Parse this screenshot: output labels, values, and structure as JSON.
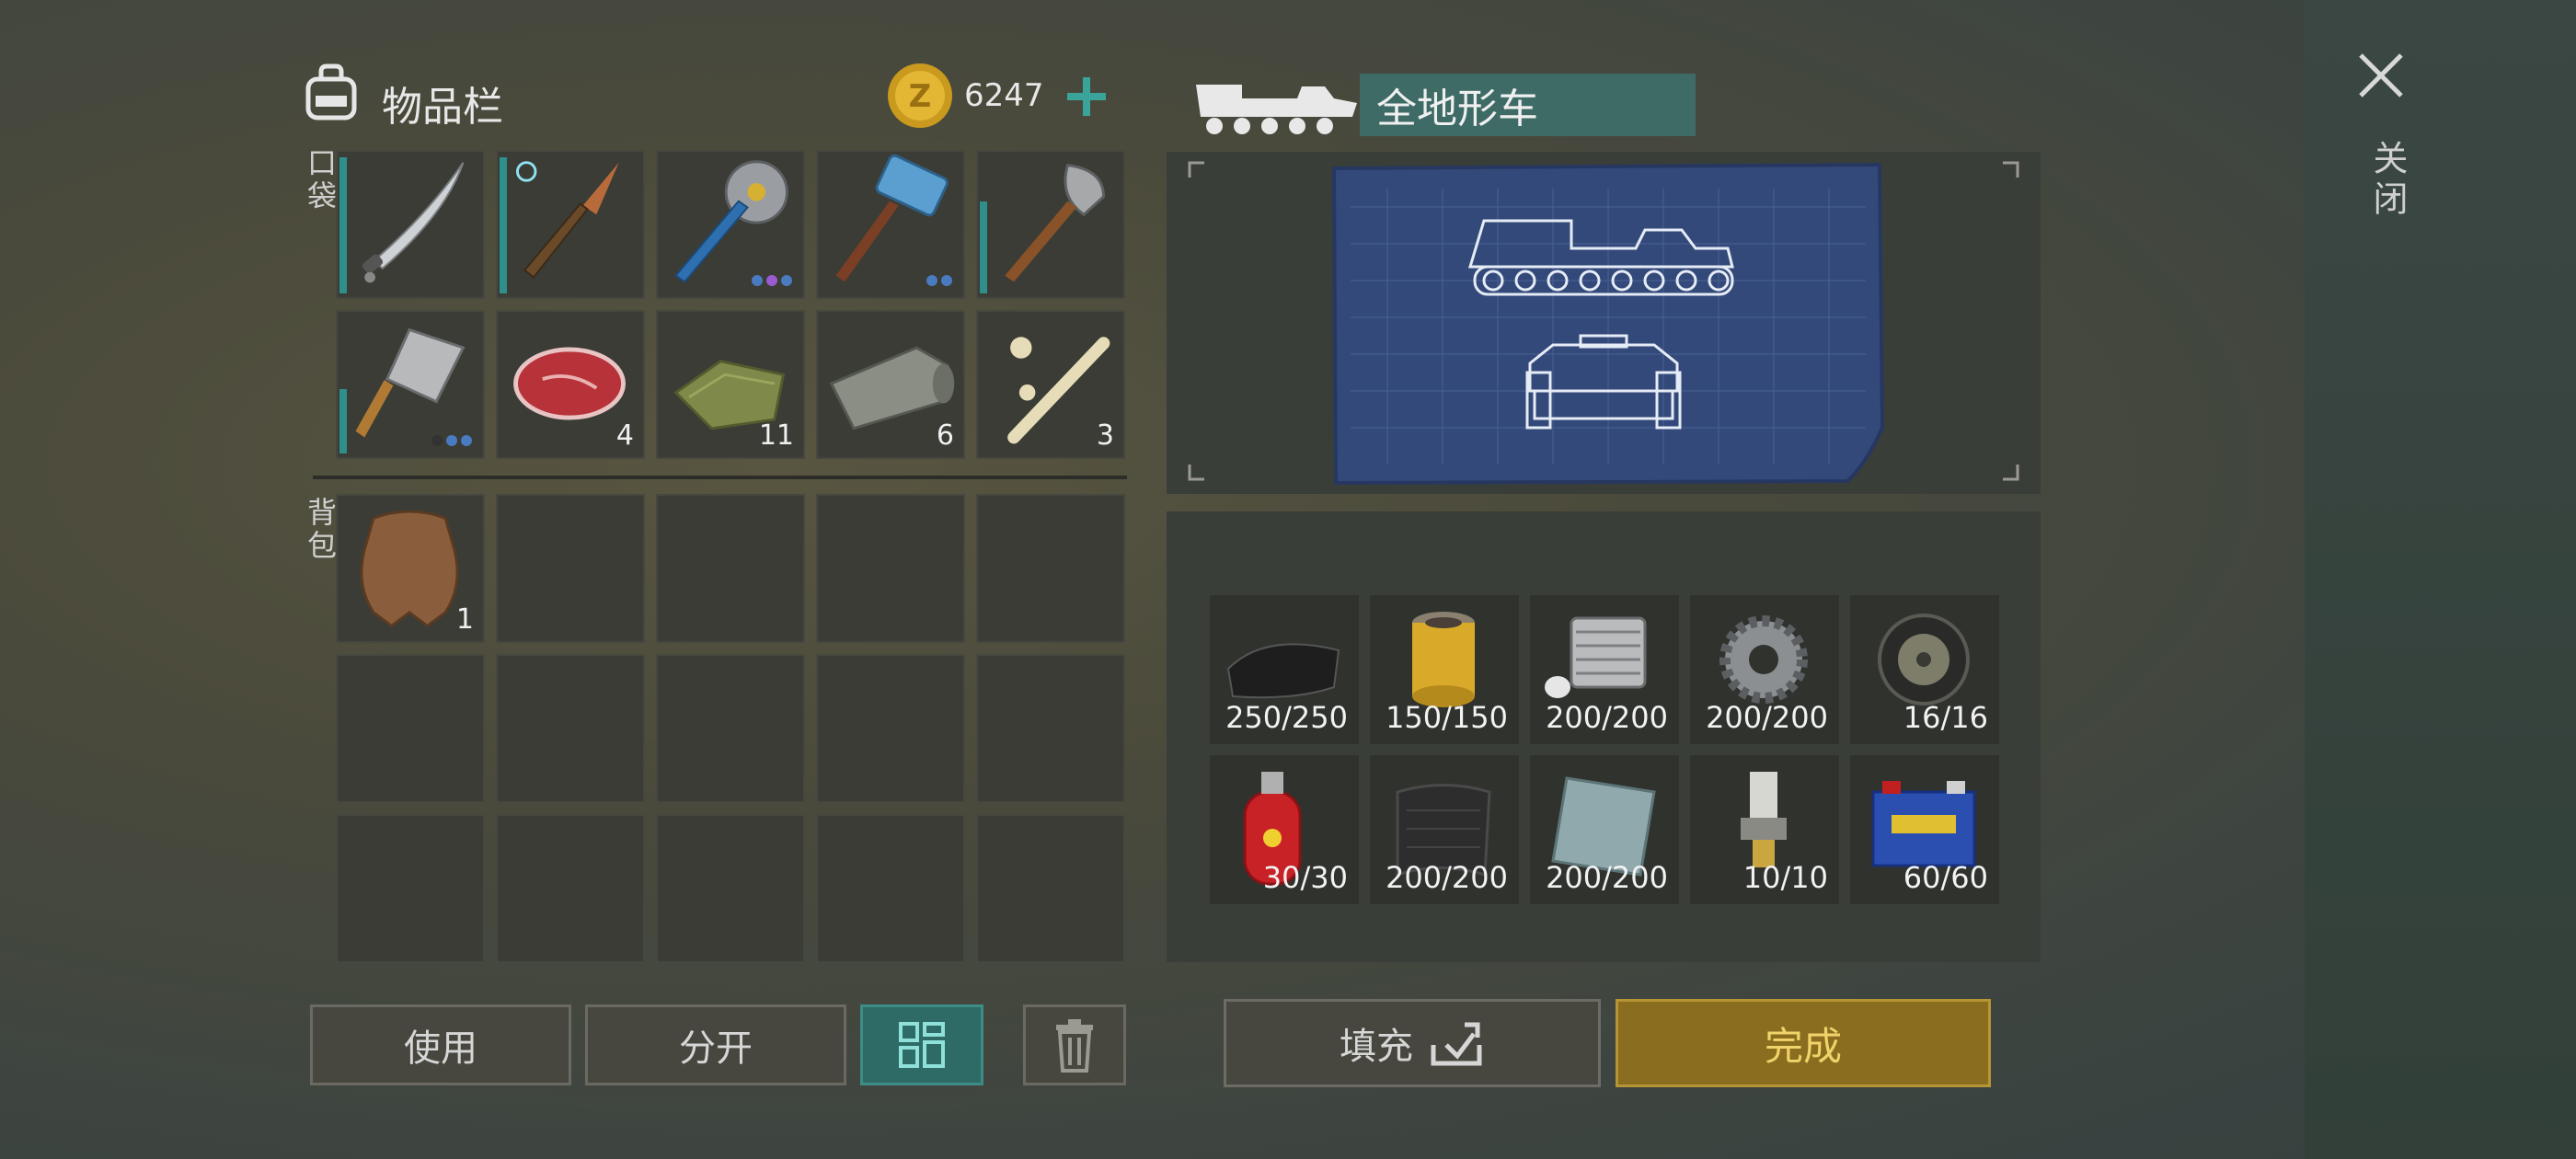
{
  "inventory": {
    "title": "物品栏",
    "pocket_label": "口袋",
    "backpack_label": "背包",
    "coins": "6247",
    "pocket_items": [
      {
        "name": "machete",
        "count": ""
      },
      {
        "name": "frost-knife",
        "count": ""
      },
      {
        "name": "saw-blade-club",
        "count": ""
      },
      {
        "name": "sledgehammer",
        "count": ""
      },
      {
        "name": "shovel",
        "count": ""
      },
      {
        "name": "cleaver",
        "count": ""
      },
      {
        "name": "raw-meat",
        "count": "4"
      },
      {
        "name": "cloth",
        "count": "11"
      },
      {
        "name": "hide-roll",
        "count": "6"
      },
      {
        "name": "bones",
        "count": "3"
      }
    ],
    "backpack_items": [
      {
        "name": "animal-hide",
        "count": "1"
      }
    ]
  },
  "buttons": {
    "use": "使用",
    "split": "分开",
    "fill": "填充",
    "done": "完成"
  },
  "vehicle": {
    "title": "全地形车"
  },
  "requirements": [
    {
      "name": "rubber-sheet",
      "amount": "250/250"
    },
    {
      "name": "air-filter",
      "amount": "150/150"
    },
    {
      "name": "engine-cylinder",
      "amount": "200/200"
    },
    {
      "name": "gear",
      "amount": "200/200"
    },
    {
      "name": "wheel",
      "amount": "16/16"
    },
    {
      "name": "gas-cylinder",
      "amount": "30/30"
    },
    {
      "name": "carbon-fabric",
      "amount": "200/200"
    },
    {
      "name": "steel-plate",
      "amount": "200/200"
    },
    {
      "name": "spark-plug",
      "amount": "10/10"
    },
    {
      "name": "battery",
      "amount": "60/60"
    }
  ],
  "close": {
    "label": "关闭"
  },
  "colors": {
    "accent_teal": "#3e6b66",
    "done_gold": "#8a6d1e",
    "durability": "#2f8f8a"
  }
}
